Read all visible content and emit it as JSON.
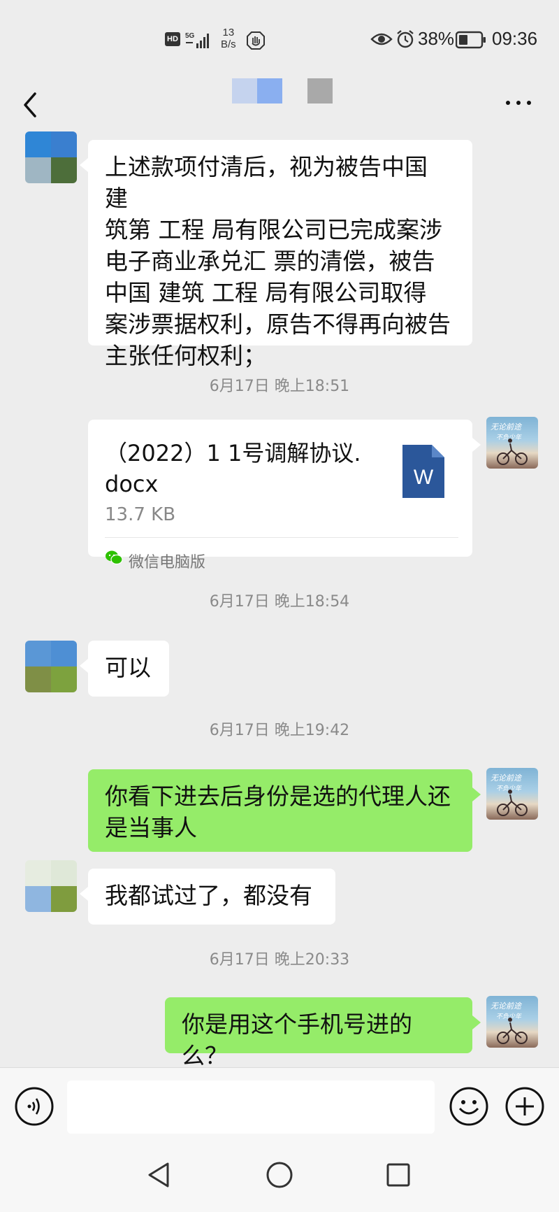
{
  "status_bar": {
    "hd": "HD",
    "network": "5G",
    "speed_value": "13",
    "speed_unit": "B/s",
    "battery_percent": "38%",
    "time": "09:36"
  },
  "header": {
    "title_colors": [
      "#c5d3ee",
      "#8aaff0",
      "#ffffff",
      "#a9a9a9"
    ]
  },
  "messages": {
    "m1_text": "上述款项付清后，视为被告中国  建\n筑第  工程  局有限公司已完成案涉\n电子商业承兑汇 票的清偿，被告\n中国  建筑  工程  局有限公司取得\n案涉票据权利，原告不得再向被告\n主张任何权利；",
    "ts1": "6月17日 晚上18:51",
    "file": {
      "name": "（2022）1  1号调解协议.\ndocx",
      "size": "13.7 KB",
      "icon_label": "W",
      "source": "微信电脑版"
    },
    "ts2": "6月17日 晚上18:54",
    "m3_text": "可以",
    "ts3": "6月17日 晚上19:42",
    "m4_text": "你看下进去后身份是选的代理人还\n是当事人",
    "m5_text": "我都试过了，都没有",
    "ts4": "6月17日 晚上20:33",
    "m6_text": "你是用这个手机号进的么？"
  },
  "input": {
    "placeholder": ""
  },
  "colors": {
    "sent_bubble": "#95ec69",
    "received_bubble": "#ffffff",
    "background": "#ededed",
    "word_icon": "#2b579a"
  },
  "icons": [
    "signal-icon",
    "hand-icon",
    "eye-icon",
    "alarm-icon",
    "battery-icon",
    "back-arrow-icon",
    "more-icon",
    "word-file-icon",
    "wechat-icon",
    "voice-icon",
    "emoji-icon",
    "plus-icon",
    "nav-back-icon",
    "nav-home-icon",
    "nav-recent-icon"
  ]
}
